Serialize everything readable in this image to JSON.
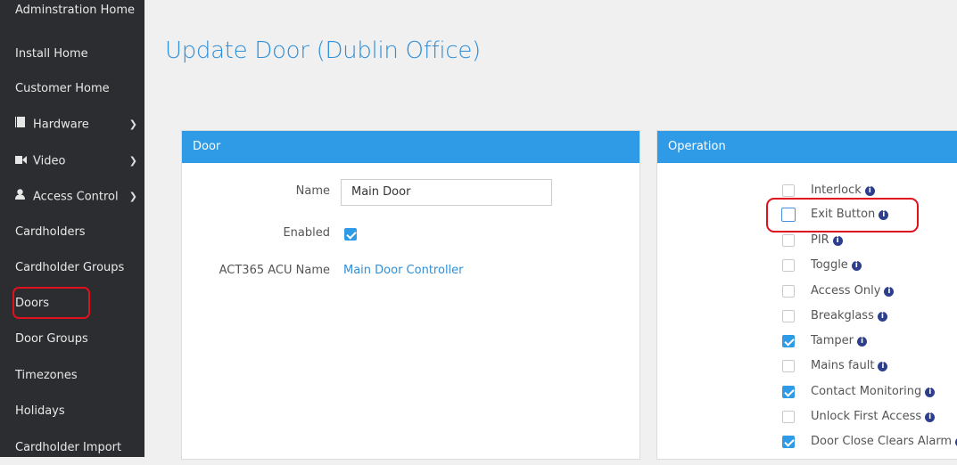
{
  "sidebar": {
    "items": [
      {
        "label": "Adminstration Home"
      },
      {
        "label": "Install Home"
      },
      {
        "label": "Customer Home"
      },
      {
        "label": "Hardware",
        "icon": "book-icon",
        "expandable": true
      },
      {
        "label": "Video",
        "icon": "video-camera-icon",
        "expandable": true
      },
      {
        "label": "Access Control",
        "icon": "user-icon",
        "expandable": true
      },
      {
        "label": "Cardholders"
      },
      {
        "label": "Cardholder Groups"
      },
      {
        "label": "Doors",
        "highlighted": true
      },
      {
        "label": "Door Groups"
      },
      {
        "label": "Timezones"
      },
      {
        "label": "Holidays"
      },
      {
        "label": "Cardholder Import"
      }
    ]
  },
  "page": {
    "title": "Update Door (Dublin Office)"
  },
  "door_panel": {
    "header": "Door",
    "name_label": "Name",
    "name_value": "Main Door",
    "enabled_label": "Enabled",
    "enabled_checked": true,
    "acu_label": "ACT365 ACU Name",
    "acu_link": "Main Door Controller"
  },
  "operation_panel": {
    "header": "Operation",
    "options": [
      {
        "label": "Interlock",
        "checked": false
      },
      {
        "label": "Exit Button",
        "checked": false,
        "highlighted": true
      },
      {
        "label": "PIR",
        "checked": false
      },
      {
        "label": "Toggle",
        "checked": false
      },
      {
        "label": "Access Only",
        "checked": false
      },
      {
        "label": "Breakglass",
        "checked": false
      },
      {
        "label": "Tamper",
        "checked": true
      },
      {
        "label": "Mains fault",
        "checked": false
      },
      {
        "label": "Contact Monitoring",
        "checked": true
      },
      {
        "label": "Unlock First Access",
        "checked": false
      },
      {
        "label": "Door Close Clears Alarm",
        "checked": true
      }
    ]
  },
  "colors": {
    "accent": "#2f9ae6",
    "sidebar_bg": "#2b2d30",
    "highlight": "#e0111c"
  }
}
